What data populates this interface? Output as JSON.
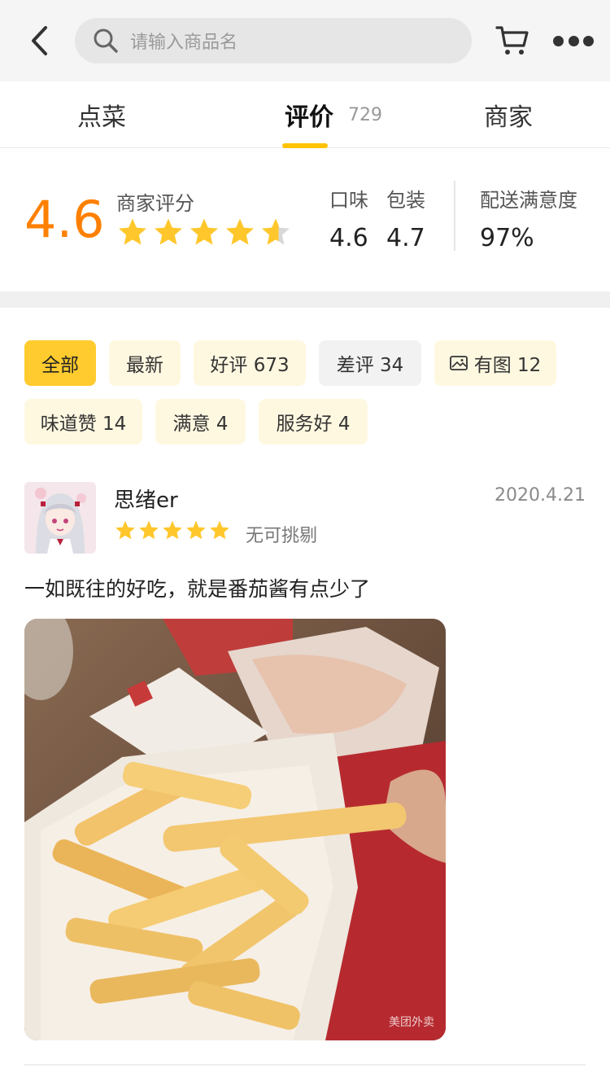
{
  "search": {
    "placeholder": "请输入商品名"
  },
  "tabs": [
    {
      "label": "点菜"
    },
    {
      "label": "评价",
      "count": "729"
    },
    {
      "label": "商家"
    }
  ],
  "score": {
    "overall": "4.6",
    "overall_label": "商家评分",
    "overall_stars": 4.6,
    "taste_label": "口味",
    "taste_value": "4.6",
    "packaging_label": "包装",
    "packaging_value": "4.7",
    "delivery_label": "配送满意度",
    "delivery_value": "97%"
  },
  "filters": [
    {
      "label": "全部",
      "active": true
    },
    {
      "label": "最新"
    },
    {
      "label": "好评 673"
    },
    {
      "label": "差评 34"
    },
    {
      "label": "有图 12",
      "icon": "image-icon"
    },
    {
      "label": "味道赞 14"
    },
    {
      "label": "满意 4"
    },
    {
      "label": "服务好 4"
    }
  ],
  "review": {
    "user": "思绪er",
    "date": "2020.4.21",
    "stars": 5,
    "rating_text": "无可挑剔",
    "text": "一如既往的好吃，就是番茄酱有点少了",
    "photo_watermark": "美团外卖"
  },
  "colors": {
    "accent": "#ffc300",
    "score_orange": "#ff8000",
    "star": "#ffc72c"
  }
}
